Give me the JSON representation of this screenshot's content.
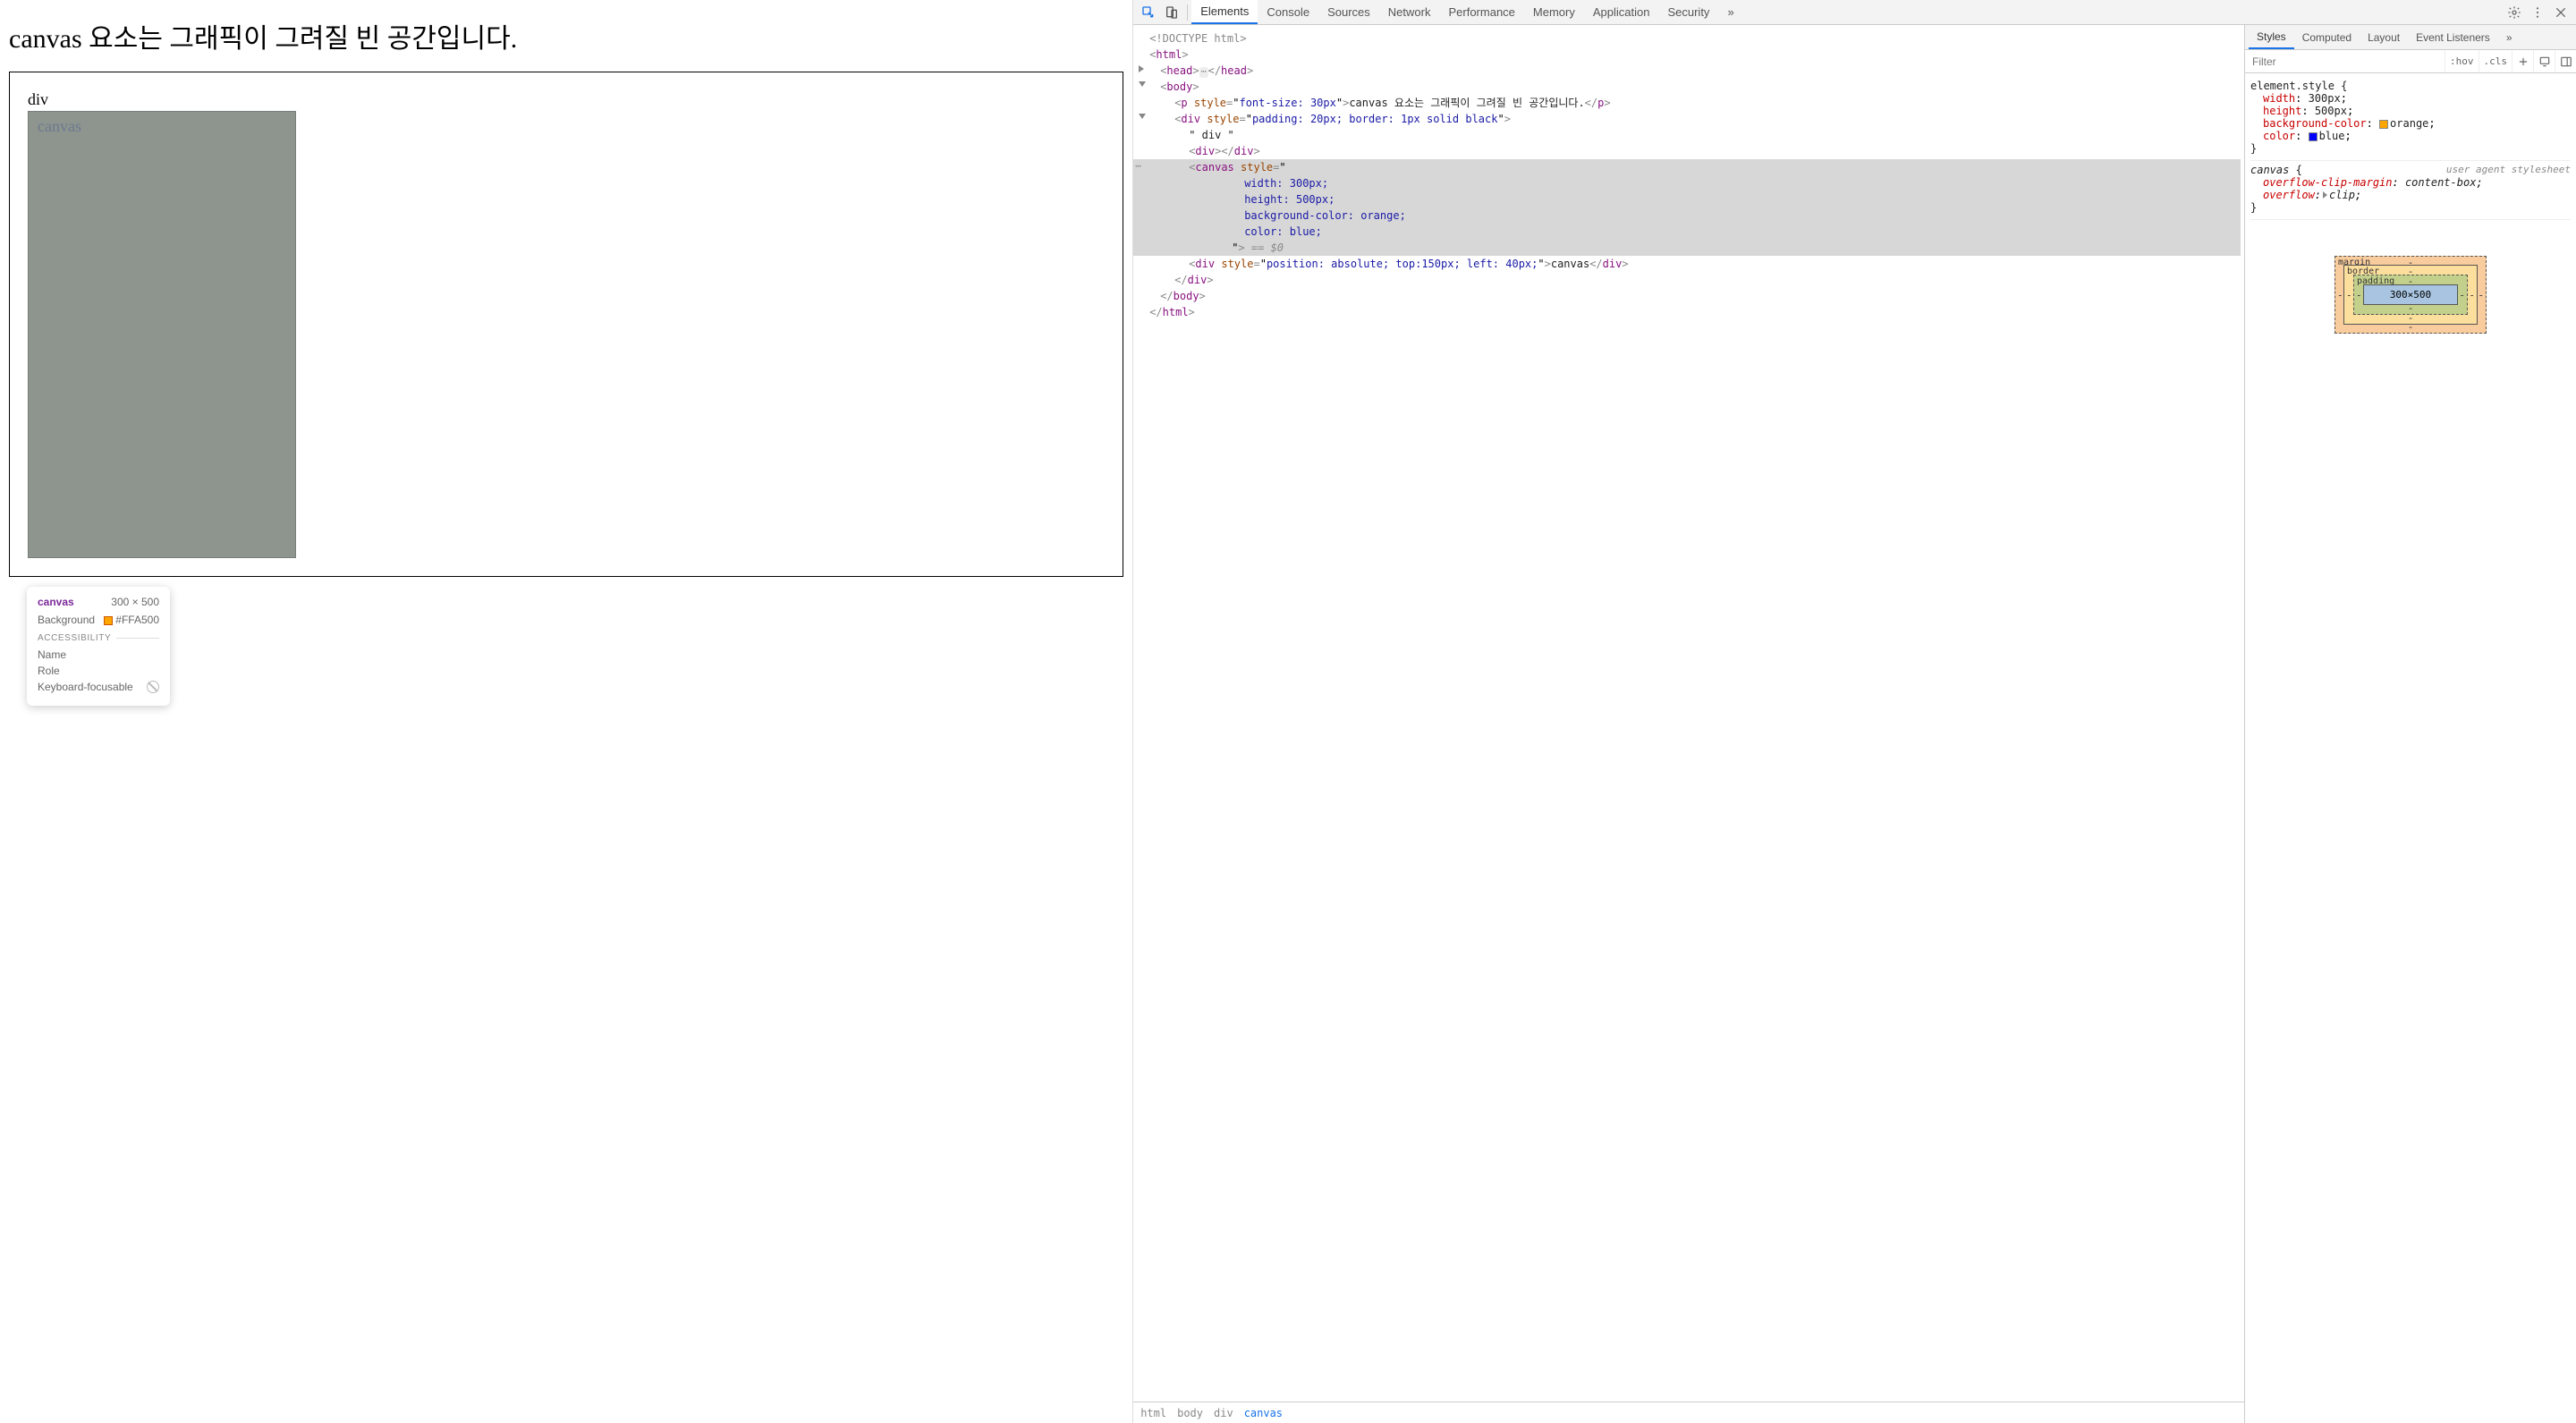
{
  "page": {
    "heading": "canvas 요소는 그래픽이 그려질 빈 공간입니다.",
    "div_label": "div",
    "canvas_label": "canvas"
  },
  "tooltip": {
    "elementName": "canvas",
    "dimensions": "300 × 500",
    "backgroundLabel": "Background",
    "backgroundValue": "#FFA500",
    "a11yHeader": "ACCESSIBILITY",
    "nameLabel": "Name",
    "roleLabel": "Role",
    "kbFocusLabel": "Keyboard-focusable"
  },
  "devtools": {
    "tabs": [
      "Elements",
      "Console",
      "Sources",
      "Network",
      "Performance",
      "Memory",
      "Application",
      "Security"
    ],
    "moreGlyph": "»",
    "dom": {
      "doctype": "<!DOCTYPE html>",
      "html_open": "html",
      "head_open": "head",
      "head_close": "head",
      "body_open": "body",
      "p_attr_name": "style",
      "p_attr_val": "font-size: 30px",
      "p_text": "canvas 요소는 그래픽이 그려질 빈 공간입니다.",
      "p_close": "p",
      "divwrap_attr_name": "style",
      "divwrap_attr_val": "padding: 20px; border: 1px solid black",
      "divwrap_tag": "div",
      "div_text": "\" div \"",
      "emptydiv": "div",
      "canvas_tag": "canvas",
      "canvas_attr_name": "style",
      "canvas_style_l1": "width: 300px;",
      "canvas_style_l2": "height: 500px;",
      "canvas_style_l3": "background-color: orange;",
      "canvas_style_l4": "color: blue;",
      "canvas_eq": "== $0",
      "posdiv_attr_name": "style",
      "posdiv_attr_val": "position: absolute; top:150px; left: 40px;",
      "posdiv_text": "canvas",
      "divwrap_close": "div",
      "body_close": "body",
      "html_close": "html"
    },
    "breadcrumbs": [
      "html",
      "body",
      "div",
      "canvas"
    ],
    "styleTabs": [
      "Styles",
      "Computed",
      "Layout",
      "Event Listeners"
    ],
    "filterPlaceholder": "Filter",
    "hov": ":hov",
    "cls": ".cls",
    "rules": {
      "r1_sel": "element.style",
      "r1_p1_n": "width",
      "r1_p1_v": "300px",
      "r1_p2_n": "height",
      "r1_p2_v": "500px",
      "r1_p3_n": "background-color",
      "r1_p3_v": "orange",
      "r1_p4_n": "color",
      "r1_p4_v": "blue",
      "r2_sel": "canvas",
      "r2_origin": "user agent stylesheet",
      "r2_p1_n": "overflow-clip-margin",
      "r2_p1_v": "content-box",
      "r2_p2_n": "overflow",
      "r2_p2_v": "clip"
    },
    "boxModel": {
      "margin": "margin",
      "border": "border",
      "padding": "padding",
      "content": "300×500",
      "dash": "-"
    }
  }
}
